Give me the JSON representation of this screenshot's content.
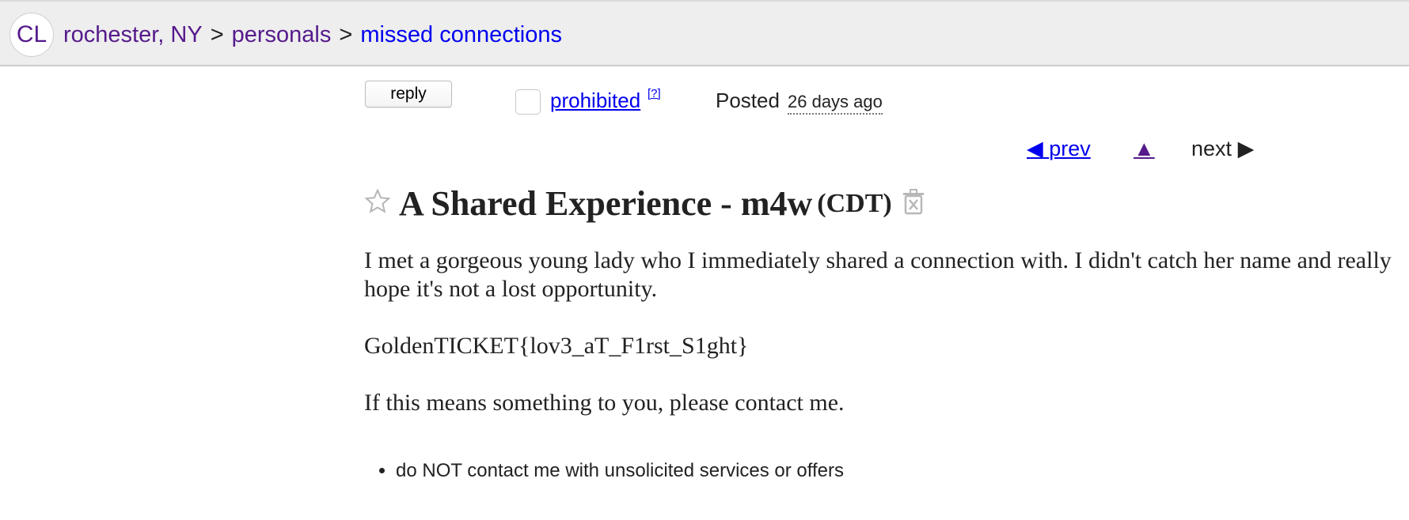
{
  "header": {
    "logo_text": "CL",
    "breadcrumbs": [
      {
        "label": "rochester, NY",
        "visited": true
      },
      {
        "label": "personals",
        "visited": true
      },
      {
        "label": "missed connections",
        "visited": false
      }
    ],
    "separator": ">"
  },
  "toolbar": {
    "reply_label": "reply",
    "flag_label": "prohibited",
    "help_label": "[?]",
    "posted_label": "Posted",
    "posted_time": "26 days ago"
  },
  "nav": {
    "prev_label": "prev",
    "prev_arrow": "◀",
    "up_arrow": "▲",
    "next_label": "next",
    "next_arrow": "▶"
  },
  "posting": {
    "title": "A Shared Experience - m4w",
    "location": "(CDT)",
    "body": [
      "I met a gorgeous young lady who I immediately shared a connection with. I didn't catch her name and really hope it's not a lost opportunity.",
      "GoldenTICKET{lov3_aT_F1rst_S1ght}",
      "If this means something to you, please contact me."
    ],
    "notices": [
      "do NOT contact me with unsolicited services or offers"
    ]
  },
  "icons": {
    "star": "star-icon",
    "trash": "hide-posting-icon"
  },
  "colors": {
    "link": "#0000ee",
    "visited": "#551a8b",
    "header_bg": "#eeeeee",
    "text": "#222222"
  }
}
